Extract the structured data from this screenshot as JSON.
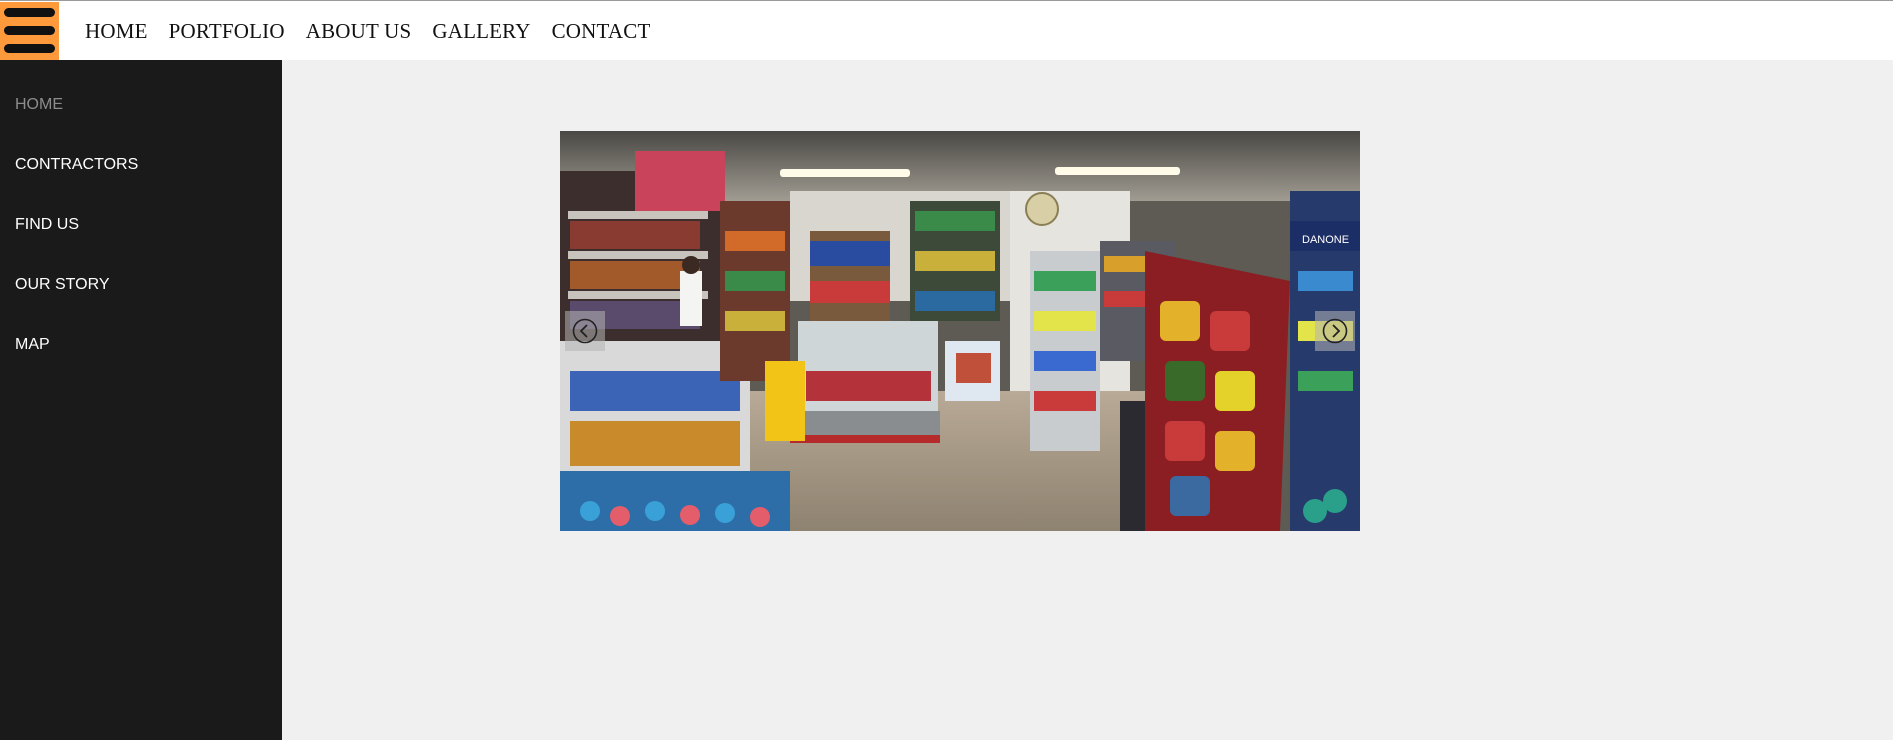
{
  "top_nav": {
    "menu_icon": "hamburger-menu-icon",
    "items": [
      "HOME",
      "PORTFOLIO",
      "ABOUT US",
      "GALLERY",
      "CONTACT"
    ]
  },
  "sidebar": {
    "items": [
      {
        "label": "HOME",
        "active": true
      },
      {
        "label": "CONTRACTORS",
        "active": false
      },
      {
        "label": "FIND US",
        "active": false
      },
      {
        "label": "OUR STORY",
        "active": false
      },
      {
        "label": "MAP",
        "active": false
      }
    ]
  },
  "slider": {
    "image_subject": "convenience store interior panorama",
    "prev_icon": "chevron-left-circle-icon",
    "next_icon": "chevron-right-circle-icon",
    "sign_text": "DANONE"
  },
  "colors": {
    "hamburger_bg": "#ff9a3c",
    "sidebar_bg": "#1a1a1a",
    "page_bg": "#f0f0f0",
    "active_sidebar_text": "#8c8c8c"
  }
}
